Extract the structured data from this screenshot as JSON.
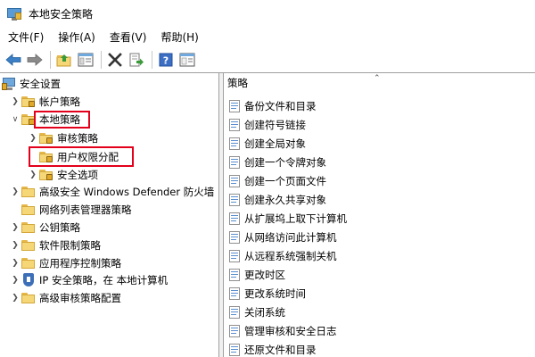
{
  "window": {
    "title": "本地安全策略"
  },
  "menu": [
    "文件(F)",
    "操作(A)",
    "查看(V)",
    "帮助(H)"
  ],
  "toolbar": {
    "buttons": [
      "back-icon",
      "forward-icon",
      "up-folder-icon",
      "show-hide-tree-icon",
      "delete-icon",
      "export-icon",
      "help-icon",
      "properties-icon"
    ]
  },
  "tree": {
    "root": "安全设置",
    "account_policy": "帐户策略",
    "local_policy": "本地策略",
    "audit_policy": "审核策略",
    "user_rights": "用户权限分配",
    "security_options": "安全选项",
    "defender_firewall": "高级安全 Windows Defender 防火墙",
    "network_list": "网络列表管理器策略",
    "public_key": "公钥策略",
    "software_restriction": "软件限制策略",
    "app_control": "应用程序控制策略",
    "ip_security": "IP 安全策略，在 本地计算机",
    "advanced_audit": "高级审核策略配置"
  },
  "right": {
    "column_header": "策略",
    "policies": [
      "备份文件和目录",
      "创建符号链接",
      "创建全局对象",
      "创建一个令牌对象",
      "创建一个页面文件",
      "创建永久共享对象",
      "从扩展坞上取下计算机",
      "从网络访问此计算机",
      "从远程系统强制关机",
      "更改时区",
      "更改系统时间",
      "关闭系统",
      "管理审核和安全日志",
      "还原文件和目录"
    ]
  },
  "colors": {
    "highlight_box": "#e3001b",
    "folder": "#f6d778",
    "pane_border": "#a0a0a0"
  }
}
